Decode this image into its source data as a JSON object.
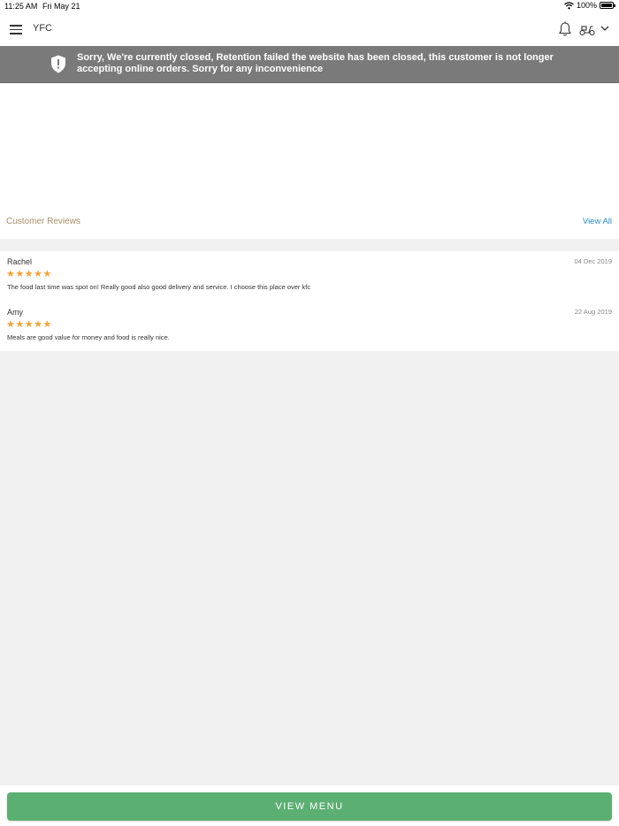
{
  "status_bar": {
    "time": "11:25 AM",
    "date": "Fri May 21",
    "battery": "100%"
  },
  "header": {
    "title": "YFC"
  },
  "banner": {
    "message": "Sorry, We're currently closed, Retention failed the website has been closed, this customer is not longer accepting online orders. Sorry for any inconvenience"
  },
  "reviews": {
    "title": "Customer Reviews",
    "view_all": "View All",
    "items": [
      {
        "name": "Rachel",
        "date": "04 Dec 2019",
        "stars": "★★★★★",
        "rating": 5,
        "text": "The food last time was spot on! Really good also good delivery and service. I choose this place over kfc"
      },
      {
        "name": "Amy",
        "date": "22 Aug 2019",
        "stars": "★★★★★",
        "rating": 5,
        "text": "Meals are good value for money and food is really nice."
      }
    ]
  },
  "footer": {
    "view_menu_label": "VIEW MENU"
  },
  "colors": {
    "banner_bg": "#7a7a7a",
    "reviews_title": "#a89068",
    "link": "#2b8cc4",
    "star": "#f5a133",
    "button": "#5caf72"
  },
  "icons": [
    "wifi-icon",
    "battery-icon",
    "menu-icon",
    "bell-icon",
    "scooter-icon",
    "chevron-down-icon",
    "shield-alert-icon",
    "star-icon"
  ]
}
